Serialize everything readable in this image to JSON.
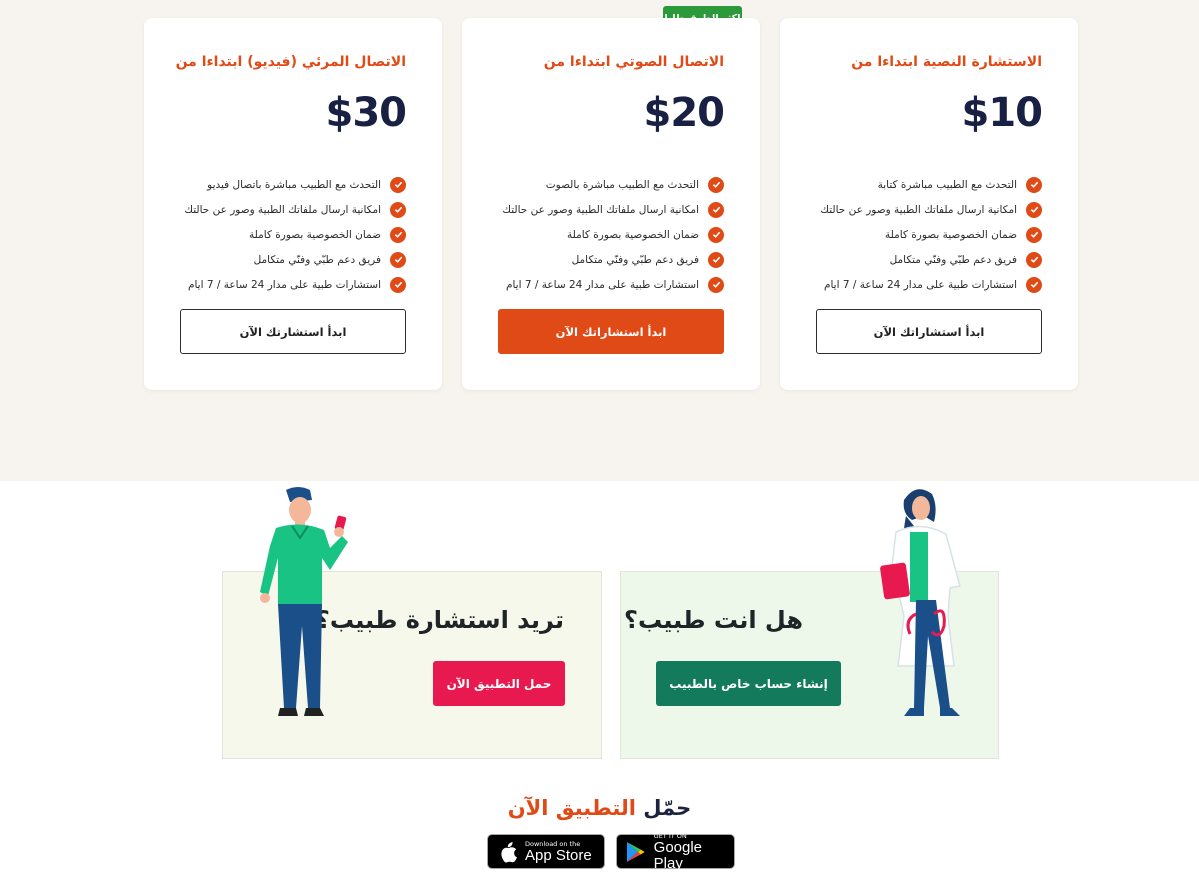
{
  "pricing": {
    "badge": "اكثر الطرق طلبا",
    "plans": [
      {
        "title": "الاستشارة النصية ابتداءا من",
        "price": "$10",
        "features": [
          "التحدث مع الطبيب مباشرة كتابة",
          "امكانية ارسال ملفاتك الطبية وصور عن حالتك",
          "ضمان الخصوصية بصورة كاملة",
          "فريق دعم طبّي وفنّي متكامل",
          "استشارات طبية على مدار 24 ساعة / 7 ايام"
        ],
        "button": "ابدأ استشاراتك الآن"
      },
      {
        "title": "الاتصال الصوتي ابتداءا من",
        "price": "$20",
        "features": [
          "التحدث مع الطبيب مباشرة بالصوت",
          "امكانية ارسال ملفاتك الطبية وصور عن حالتك",
          "ضمان الخصوصية بصورة كاملة",
          "فريق دعم طبّي وفنّي متكامل",
          "استشارات طبية على مدار 24 ساعة / 7 ايام"
        ],
        "button": "ابدأ استشاراتك الآن"
      },
      {
        "title": "الاتصال المرئي (فيديو) ابتداءا من",
        "price": "$30",
        "features": [
          "التحدث مع الطبيب مباشرة باتصال فيديو",
          "امكانية ارسال ملفاتك الطبية وصور عن حالتك",
          "ضمان الخصوصية بصورة كاملة",
          "فريق دعم طبّي وفنّي متكامل",
          "استشارات طبية على مدار 24 ساعة / 7 ايام"
        ],
        "button": "ابدأ استشارتك الآن"
      }
    ]
  },
  "patient": {
    "heading": "تريد استشارة طبيب؟",
    "button": "حمل التطبيق الآن",
    "color": "#e8194f"
  },
  "doctor": {
    "heading": "هل انت طبيب؟",
    "button": "إنشاء حساب خاص بالطبيب",
    "color": "#137b5c"
  },
  "download": {
    "title_part1": "حمّل",
    "title_part2": "التطبيق الآن",
    "app_store": {
      "small": "Download on the",
      "big": "App Store",
      "icon": "apple-icon"
    },
    "google_play": {
      "small": "GET IT ON",
      "big": "Google Play",
      "icon": "google-play-icon"
    }
  },
  "colors": {
    "accent": "#e04a17",
    "navy": "#182044",
    "badge": "#2c9a3a",
    "section_bg": "#f7f3ee"
  }
}
